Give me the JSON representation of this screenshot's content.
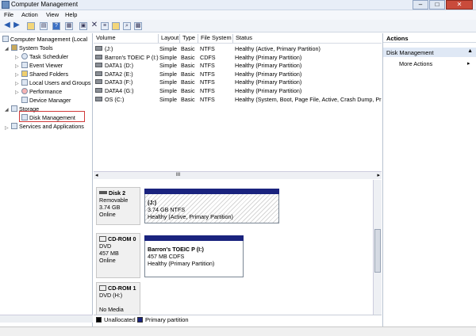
{
  "window": {
    "title": "Computer Management"
  },
  "menu": [
    "File",
    "Action",
    "View",
    "Help"
  ],
  "toolbar": {
    "icons": [
      "back-arrow-icon",
      "forward-arrow-icon",
      "up-folder-icon",
      "show-hide-tree-icon",
      "help-icon",
      "properties-icon",
      "delete-icon",
      "folder-open-icon",
      "search-icon",
      "properties2-icon"
    ]
  },
  "tree": {
    "root": "Computer Management (Local",
    "system_tools": "System Tools",
    "task_scheduler": "Task Scheduler",
    "event_viewer": "Event Viewer",
    "shared_folders": "Shared Folders",
    "local_users": "Local Users and Groups",
    "performance": "Performance",
    "device_manager": "Device Manager",
    "storage": "Storage",
    "disk_management": "Disk Management",
    "services": "Services and Applications"
  },
  "volumes": {
    "columns": [
      "Volume",
      "Layout",
      "Type",
      "File System",
      "Status"
    ],
    "rows": [
      [
        "(J:)",
        "Simple",
        "Basic",
        "NTFS",
        "Healthy (Active, Primary Partition)"
      ],
      [
        "Barron's TOEIC P (I:)",
        "Simple",
        "Basic",
        "CDFS",
        "Healthy (Primary Partition)"
      ],
      [
        "DATA1 (D:)",
        "Simple",
        "Basic",
        "NTFS",
        "Healthy (Primary Partition)"
      ],
      [
        "DATA2 (E:)",
        "Simple",
        "Basic",
        "NTFS",
        "Healthy (Primary Partition)"
      ],
      [
        "DATA3 (F:)",
        "Simple",
        "Basic",
        "NTFS",
        "Healthy (Primary Partition)"
      ],
      [
        "DATA4 (G:)",
        "Simple",
        "Basic",
        "NTFS",
        "Healthy (Primary Partition)"
      ],
      [
        "OS (C:)",
        "Simple",
        "Basic",
        "NTFS",
        "Healthy (System, Boot, Page File, Active, Crash Dump, Pri"
      ]
    ],
    "scroll_mark": "III"
  },
  "disks": {
    "disk2": {
      "name": "Disk 2",
      "kind": "Removable",
      "size": "3.74 GB",
      "state": "Online",
      "part_name": "(J:)",
      "part_size": "3.74 GB NTFS",
      "part_status": "Healthy (Active, Primary Partition)"
    },
    "cdrom0": {
      "name": "CD-ROM 0",
      "kind": "DVD",
      "size": "457 MB",
      "state": "Online",
      "part_name": "Barron's TOEIC P  (I:)",
      "part_size": "457 MB CDFS",
      "part_status": "Healthy (Primary Partition)"
    },
    "cdrom1": {
      "name": "CD-ROM 1",
      "kind": "DVD (H:)",
      "state": "No Media"
    }
  },
  "legend": {
    "unallocated": "Unallocated",
    "primary": "Primary partition",
    "unallocated_color": "#000000",
    "primary_color": "#1a237e"
  },
  "actions": {
    "header": "Actions",
    "section": "Disk Management",
    "more": "More Actions"
  }
}
